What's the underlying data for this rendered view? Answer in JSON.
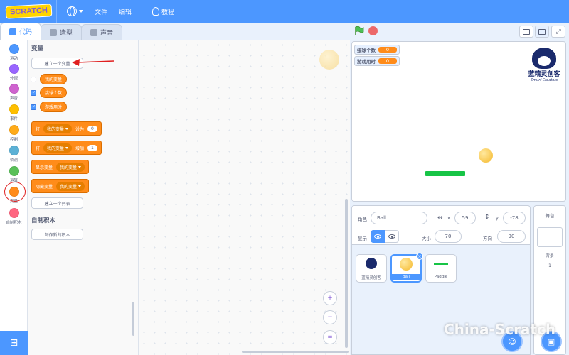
{
  "app": {
    "logo_text": "SCRATCH",
    "menu": {
      "file": "文件",
      "edit": "编辑",
      "tutorials": "教程"
    }
  },
  "tabs": [
    {
      "label": "代码",
      "active": true
    },
    {
      "label": "造型",
      "active": false
    },
    {
      "label": "声音",
      "active": false
    }
  ],
  "categories": [
    {
      "label": "运动",
      "color": "#4c97ff"
    },
    {
      "label": "外观",
      "color": "#9966ff"
    },
    {
      "label": "声音",
      "color": "#cf63cf"
    },
    {
      "label": "事件",
      "color": "#ffbf00"
    },
    {
      "label": "控制",
      "color": "#ffab19"
    },
    {
      "label": "侦测",
      "color": "#5cb1d6"
    },
    {
      "label": "运算",
      "color": "#59c059"
    },
    {
      "label": "变量",
      "color": "#ff8c1a",
      "selected": true
    },
    {
      "label": "自制积木",
      "color": "#ff6680"
    }
  ],
  "palette": {
    "variables_heading": "变量",
    "make_variable_button": "建立一个变量",
    "variables": [
      {
        "name": "我的变量",
        "checked": false
      },
      {
        "name": "接球个数",
        "checked": true
      },
      {
        "name": "游戏用时",
        "checked": true
      }
    ],
    "set_block": {
      "prefix": "将",
      "var": "我的变量",
      "op": "设为",
      "value": "0"
    },
    "change_block": {
      "prefix": "将",
      "var": "我的变量",
      "op": "增加",
      "value": "1"
    },
    "show_block": {
      "label": "显示变量",
      "var": "我的变量"
    },
    "hide_block": {
      "label": "隐藏变量",
      "var": "我的变量"
    },
    "make_list_button": "建立一个列表",
    "my_blocks_heading": "自制积木",
    "make_block_button": "制作新的积木"
  },
  "zoom": {
    "in": "+",
    "out": "−",
    "reset": "="
  },
  "stage": {
    "monitors": [
      {
        "label": "接球个数",
        "value": "0"
      },
      {
        "label": "游戏用时",
        "value": "0"
      }
    ],
    "logo_text": "蓝精灵创客",
    "logo_sub": "Smurf Creators"
  },
  "sprite_info": {
    "sprite_label": "角色",
    "sprite_name": "Ball",
    "x_label": "x",
    "x_value": "59",
    "y_label": "y",
    "y_value": "-78",
    "show_label": "显示",
    "size_label": "大小",
    "size_value": "70",
    "direction_label": "方向",
    "direction_value": "90"
  },
  "sprites": [
    {
      "name": "蓝精灵创客",
      "selected": false
    },
    {
      "name": "Ball",
      "selected": true
    },
    {
      "name": "Paddle",
      "selected": false
    }
  ],
  "stage_pane": {
    "title": "舞台",
    "backdrops_label": "背景",
    "backdrops_count": "1"
  },
  "watermark": "China-Scratch",
  "colors": {
    "menubar": "#4c97ff",
    "variables": "#ff8c1a",
    "annotation": "#e02020",
    "paddle": "#17c446"
  }
}
